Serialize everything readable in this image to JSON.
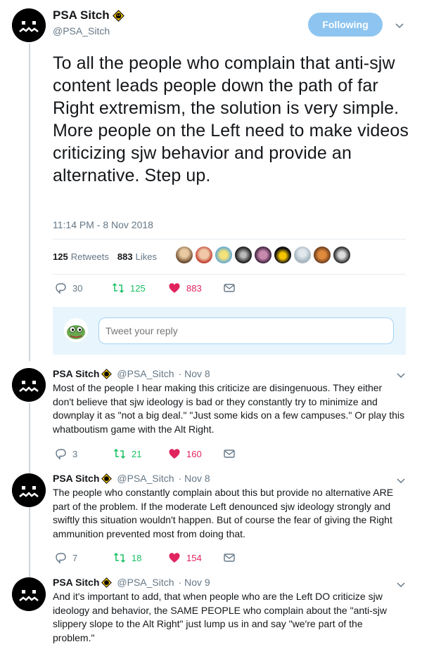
{
  "main_tweet": {
    "display_name": "PSA Sitch",
    "handle": "@PSA_Sitch",
    "follow_label": "Following",
    "text": "To all the people who complain that anti-sjw content leads people down the path of far Right extremism, the solution is very simple. More people on the Left need to make videos criticizing sjw behavior and provide an alternative. Step up.",
    "timestamp": "11:14 PM - 8 Nov 2018",
    "retweets_count": "125",
    "retweets_label": "Retweets",
    "likes_count": "883",
    "likes_label": "Likes",
    "reply_count": "30",
    "retweet_count": "125",
    "like_count": "883",
    "liker_avatars": 10
  },
  "reply_box": {
    "placeholder": "Tweet your reply"
  },
  "replies": [
    {
      "display_name": "PSA Sitch",
      "handle": "@PSA_Sitch",
      "date": "· Nov 8",
      "text": "Most of the people I hear making this criticize are disingenuous. They either don't believe that sjw ideology is bad or they constantly try to minimize and downplay it as \"not a big deal.\" \"Just some kids on a few campuses.\" Or play this whatboutism game with the Alt Right.",
      "reply_count": "3",
      "retweet_count": "21",
      "like_count": "160"
    },
    {
      "display_name": "PSA Sitch",
      "handle": "@PSA_Sitch",
      "date": "· Nov 8",
      "text": "The people who constantly complain about this but provide no alternative ARE part of the problem. If the moderate Left denounced sjw ideology strongly and swiftly this situation wouldn't happen. But of course the fear of giving the Right ammunition prevented most from doing that.",
      "reply_count": "7",
      "retweet_count": "18",
      "like_count": "154"
    },
    {
      "display_name": "PSA Sitch",
      "handle": "@PSA_Sitch",
      "date": "· Nov 9",
      "text": "And it's important to add, that when people who are the Left DO criticize sjw ideology and behavior, the SAME PEOPLE who complain about the \"anti-sjw slippery slope to the Alt Right\" just lump us in and say \"we're part of the problem.\""
    }
  ],
  "colors": {
    "follow_button": "#8ec5f0",
    "retweet_green": "#17bf63",
    "like_red": "#e0245e",
    "muted_gray": "#657786",
    "thread_line": "#ccd6dd",
    "reply_box_bg": "#e8f5fd"
  },
  "icons": [
    "verified-badge-icon",
    "chevron-down-icon",
    "reply-icon",
    "retweet-icon",
    "heart-icon",
    "direct-message-icon"
  ]
}
